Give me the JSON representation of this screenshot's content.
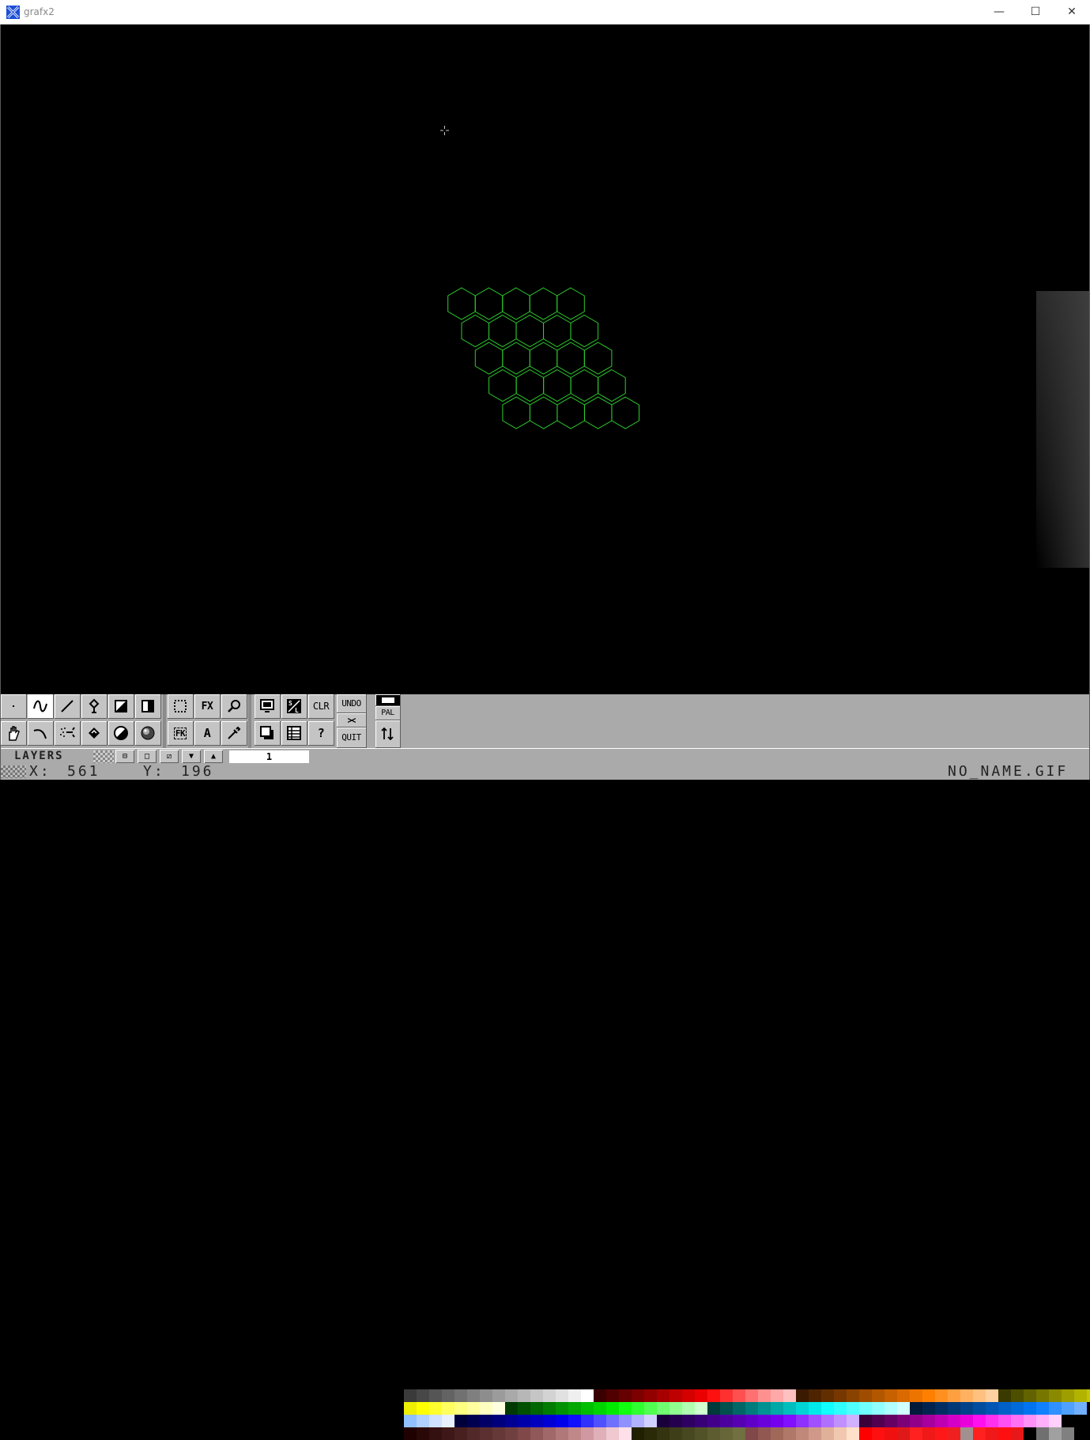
{
  "window": {
    "title": "grafx2",
    "app_icon": "grafx2-app-icon",
    "controls": {
      "minimize": "—",
      "maximize": "☐",
      "close": "✕"
    }
  },
  "canvas": {
    "background": "#000000",
    "drawing_color": "#2ecc2e",
    "cursor_icon": "crosshair-icon",
    "hex_grid": {
      "rows": 5,
      "cols_per_row": 5,
      "shape": "hexagon-outline"
    }
  },
  "toolbar": {
    "tools": [
      {
        "name": "freehand-point-tool",
        "icon": "dot-icon"
      },
      {
        "name": "freehand-continuous-tool",
        "icon": "squiggle-icon"
      },
      {
        "name": "line-tool",
        "icon": "line-icon"
      },
      {
        "name": "brush-grab-tool",
        "icon": "brush-icon"
      },
      {
        "name": "rectangle-tool",
        "icon": "rect-icon"
      },
      {
        "name": "gradient-rect-tool",
        "icon": "gradient-rect-icon"
      },
      {
        "name": "hand-tool",
        "icon": "hand-icon"
      },
      {
        "name": "curve-tool",
        "icon": "curve-icon"
      },
      {
        "name": "airbrush-tool",
        "icon": "airbrush-icon"
      },
      {
        "name": "fill-tool",
        "icon": "bucket-icon"
      },
      {
        "name": "circle-tool",
        "icon": "circle-icon"
      },
      {
        "name": "sphere-tool",
        "icon": "sphere-icon"
      }
    ],
    "fx_label": "FX",
    "text_label": "A",
    "clr_label": "CLR",
    "undo_label": "UNDO",
    "quit_label": "QUIT",
    "help_label": "?",
    "pal_label": "PAL",
    "fk_label": "FK"
  },
  "palette": {
    "row1": [
      "#3a3a3a",
      "#474747",
      "#555555",
      "#636363",
      "#717171",
      "#7f7f7f",
      "#8d8d8d",
      "#9b9b9b",
      "#a9a9a9",
      "#b7b7b7",
      "#c5c5c5",
      "#d3d3d3",
      "#e1e1e1",
      "#efefef",
      "#ffffff",
      "#3a0000",
      "#500000",
      "#660000",
      "#7c0000",
      "#920000",
      "#a80000",
      "#be0000",
      "#d40000",
      "#ea0000",
      "#ff1010",
      "#ff3030",
      "#ff5050",
      "#ff7070",
      "#ff9090",
      "#ffa8a8",
      "#ffc0c0",
      "#3a1a00",
      "#4e2400",
      "#622e00",
      "#763800",
      "#8a4200",
      "#9e4c00",
      "#b25600",
      "#c66000",
      "#da6a00",
      "#ee7400",
      "#ff8000",
      "#ff9020",
      "#ffa040",
      "#ffb060",
      "#ffc080",
      "#ffd0a0",
      "#3a3a00",
      "#4e4e00",
      "#626200",
      "#767600",
      "#8a8a00",
      "#9e9e00",
      "#b2b200",
      "#c6c600",
      "#dada00"
    ],
    "row2": [
      "#eeee00",
      "#ffff00",
      "#ffff30",
      "#ffff60",
      "#ffff80",
      "#ffffa0",
      "#ffffc0",
      "#ffffe0",
      "#003a00",
      "#005000",
      "#006600",
      "#007c00",
      "#009200",
      "#00a800",
      "#00be00",
      "#00d400",
      "#00ea00",
      "#10ff10",
      "#30ff30",
      "#50ff50",
      "#70ff70",
      "#90ff90",
      "#b0ffb0",
      "#d0ffd0",
      "#003a3a",
      "#005050",
      "#006666",
      "#007c7c",
      "#009292",
      "#00a8a8",
      "#00bebe",
      "#00d4d4",
      "#00eaea",
      "#10ffff",
      "#30ffff",
      "#50ffff",
      "#70ffff",
      "#90ffff",
      "#b0ffff",
      "#d0ffff",
      "#001a3a",
      "#00244e",
      "#002e62",
      "#003876",
      "#00428a",
      "#004c9e",
      "#0056b2",
      "#0060c6",
      "#006ada",
      "#0074ee",
      "#1080ff",
      "#3090ff",
      "#50a0ff",
      "#70b0ff"
    ],
    "row3": [
      "#90c0ff",
      "#b0d0ff",
      "#d0e0ff",
      "#e8f0ff",
      "#00003a",
      "#000050",
      "#000066",
      "#00007c",
      "#000092",
      "#0000a8",
      "#0000be",
      "#0000d4",
      "#0000ea",
      "#1010ff",
      "#3030ff",
      "#5050ff",
      "#7070ff",
      "#9090ff",
      "#b0b0ff",
      "#d0d0ff",
      "#1a003a",
      "#24004e",
      "#2e0062",
      "#380076",
      "#42008a",
      "#4c009e",
      "#5600b2",
      "#6000c6",
      "#6a00da",
      "#7400ee",
      "#8010ff",
      "#9030ff",
      "#a050ff",
      "#b070ff",
      "#c090ff",
      "#d0b0ff",
      "#3a003a",
      "#50004e",
      "#660062",
      "#7c0076",
      "#92008a",
      "#a8009e",
      "#be00b2",
      "#d400c6",
      "#ea00da",
      "#ff10ee",
      "#ff30f0",
      "#ff50f2",
      "#ff70f4",
      "#ff90f6",
      "#ffb0f8",
      "#ffd0fa"
    ],
    "row4": [
      "#200000",
      "#2a0808",
      "#341010",
      "#3e1818",
      "#482020",
      "#522828",
      "#5c3030",
      "#663838",
      "#704040",
      "#804848",
      "#905858",
      "#a06868",
      "#b07878",
      "#c08888",
      "#d098a0",
      "#e0b0b8",
      "#f0c8d0",
      "#ffe0e8",
      "#202000",
      "#2a2a08",
      "#343410",
      "#3e3e18",
      "#484820",
      "#525228",
      "#5c5c30",
      "#666638",
      "#707040",
      "#804848",
      "#905850",
      "#a06858",
      "#b07868",
      "#c08878",
      "#d09888",
      "#e0b098",
      "#f0c8b0",
      "#ffe0c8",
      "#ff0000",
      "#ff1010",
      "#f01010",
      "#e01818",
      "#ff2020",
      "#f01818",
      "#ff1818",
      "#f02020",
      "#a09090",
      "#ff2020",
      "#f01818",
      "#ff1010",
      "#e81818",
      "#000000",
      "#707070",
      "#a0a0a0",
      "#808080",
      "#000000"
    ]
  },
  "layers": {
    "label": "LAYERS",
    "buttons": [
      "⊟",
      "□",
      "⧄",
      "▼",
      "▲"
    ],
    "active_layer": "1"
  },
  "status": {
    "x_label": "X:",
    "x_value": "561",
    "y_label": "Y:",
    "y_value": "196",
    "filename": "NO_NAME.GIF"
  }
}
